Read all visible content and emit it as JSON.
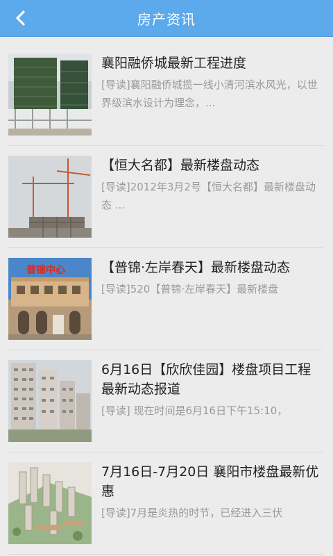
{
  "header": {
    "title": "房产资讯",
    "back_icon": "chevron-left-icon"
  },
  "colors": {
    "header_bg": "#5ca9ec",
    "title_text": "#222222",
    "summary_text": "#9a9a9a"
  },
  "news": [
    {
      "title": "襄阳融侨城最新工程进度",
      "summary": "[导读]襄阳融侨城揽一线小清河滨水风光，以世界级滨水设计为理念，..."
    },
    {
      "title": "【恒大名都】最新楼盘动态",
      "summary": "[导读]2012年3月2号【恒大名都】最新楼盘动态 ..."
    },
    {
      "title": "【普锦·左岸春天】最新楼盘动态",
      "summary": "[导读]520【普锦·左岸春天】最新楼盘",
      "sign_text": "普锦中心"
    },
    {
      "title": "6月16日【欣欣佳园】楼盘项目工程最新动态报道",
      "summary": "[导读] 现在时间是6月16日下午15:10，"
    },
    {
      "title": "7月16日-7月20日 襄阳市楼盘最新优惠",
      "summary": "[导读]7月是炎热的时节，已经进入三伏"
    }
  ]
}
